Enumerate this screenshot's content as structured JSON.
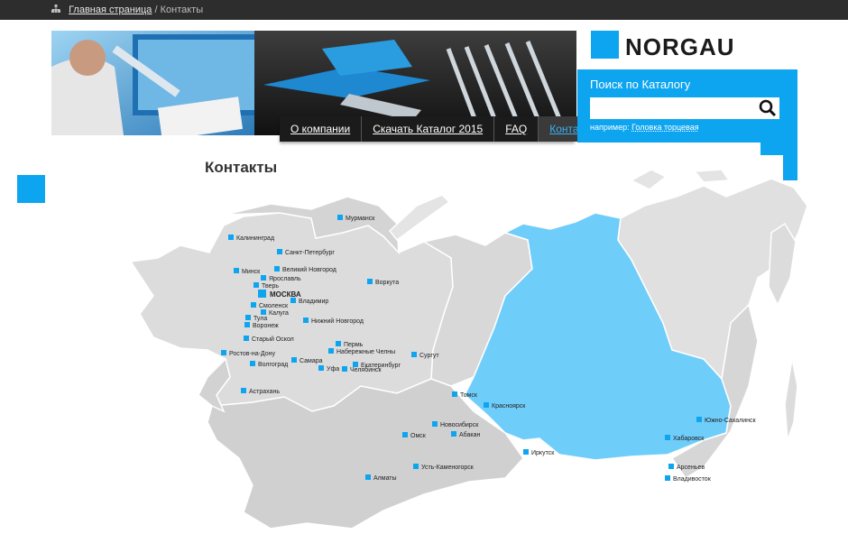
{
  "breadcrumb": {
    "home": "Главная страница",
    "sep": "/",
    "current": "Контакты"
  },
  "nav": [
    {
      "label": "О компании"
    },
    {
      "label": "Скачать Каталог 2015"
    },
    {
      "label": "FAQ"
    },
    {
      "label": "Контакты",
      "active": true
    }
  ],
  "logo": {
    "text": "NORGAU"
  },
  "search": {
    "title": "Поиск по Каталогу",
    "hint_prefix": "например:",
    "hint_example": "Головка торцевая",
    "icon": "search-icon"
  },
  "page": {
    "title": "Контакты"
  },
  "colors": {
    "accent": "#0ea5f0",
    "region_highlight": "#6fcdfa",
    "region_default": "#dcdcdc",
    "topbar": "#2d2d2d"
  },
  "map": {
    "cities": [
      {
        "name": "Мурманск"
      },
      {
        "name": "Калининград"
      },
      {
        "name": "Санкт-Петербург"
      },
      {
        "name": "Минск"
      },
      {
        "name": "Великий Новгород"
      },
      {
        "name": "Ярославль"
      },
      {
        "name": "Тверь"
      },
      {
        "name": "Воркута"
      },
      {
        "name": "МОСКВА"
      },
      {
        "name": "Владимир"
      },
      {
        "name": "Смоленск"
      },
      {
        "name": "Калуга"
      },
      {
        "name": "Тула"
      },
      {
        "name": "Воронеж"
      },
      {
        "name": "Нижний Новгород"
      },
      {
        "name": "Старый Оскол"
      },
      {
        "name": "Пермь"
      },
      {
        "name": "Набережные Челны"
      },
      {
        "name": "Ростов-на-Дону"
      },
      {
        "name": "Сургут"
      },
      {
        "name": "Самара"
      },
      {
        "name": "Волгоград"
      },
      {
        "name": "Екатеринбург"
      },
      {
        "name": "Уфа"
      },
      {
        "name": "Челябинск"
      },
      {
        "name": "Астрахань"
      },
      {
        "name": "Томск"
      },
      {
        "name": "Красноярск"
      },
      {
        "name": "Новосибирск"
      },
      {
        "name": "Абакан"
      },
      {
        "name": "Омск"
      },
      {
        "name": "Иркутск"
      },
      {
        "name": "Южно-Сахалинск"
      },
      {
        "name": "Хабаровск"
      },
      {
        "name": "Арсеньев"
      },
      {
        "name": "Владивосток"
      },
      {
        "name": "Алматы"
      },
      {
        "name": "Усть-Каменогорск"
      }
    ]
  }
}
